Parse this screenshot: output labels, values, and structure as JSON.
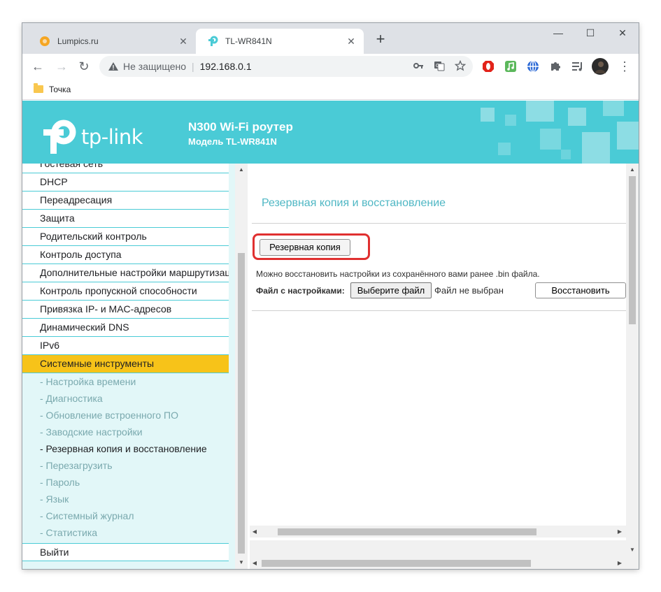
{
  "browser": {
    "tabs": [
      {
        "title": "Lumpics.ru",
        "active": false,
        "favicon": "orange-circle-icon"
      },
      {
        "title": "TL-WR841N",
        "active": true,
        "favicon": "tp-link-icon"
      }
    ],
    "new_tab": "+",
    "window_controls": {
      "minimize": "—",
      "maximize": "☐",
      "close": "✕"
    },
    "nav": {
      "back": "←",
      "forward": "→",
      "reload": "↻"
    },
    "address": {
      "security_label": "Не защищено",
      "separator": "|",
      "url": "192.168.0.1"
    },
    "bookmarks": [
      {
        "label": "Точка",
        "icon": "folder-icon"
      }
    ],
    "colors": {
      "tabstrip": "#dee1e6",
      "omnibox": "#f1f3f4"
    }
  },
  "router": {
    "brand": "tp-link",
    "header_title": "N300 Wi-Fi роутер",
    "header_model": "Модель TL-WR841N",
    "colors": {
      "accent": "#4acbd6",
      "active_menu": "#f7c319",
      "title": "#4fb7c4"
    },
    "menu": {
      "items": [
        "Гостевая сеть",
        "DHCP",
        "Переадресация",
        "Защита",
        "Родительский контроль",
        "Контроль доступа",
        "Дополнительные настройки маршрутизации",
        "Контроль пропускной способности",
        "Привязка IP- и MAC-адресов",
        "Динамический DNS",
        "IPv6",
        "Системные инструменты"
      ],
      "active": "Системные инструменты",
      "subitems": [
        "- Настройка времени",
        "- Диагностика",
        "- Обновление встроенного ПО",
        "- Заводские настройки",
        "- Резервная копия и восстановление",
        "- Перезагрузить",
        "- Пароль",
        "- Язык",
        "- Системный журнал",
        "- Статистика"
      ],
      "current_subitem": "- Резервная копия и восстановление",
      "logout": "Выйти"
    },
    "content": {
      "title": "Резервная копия и восстановление",
      "backup_button": "Резервная копия",
      "restore_note": "Можно восстановить настройки из сохранённого вами ранее .bin файла.",
      "file_label": "Файл с настройками:",
      "choose_file_button": "Выберите файл",
      "file_status": "Файл не выбран",
      "restore_button": "Восстановить"
    }
  }
}
